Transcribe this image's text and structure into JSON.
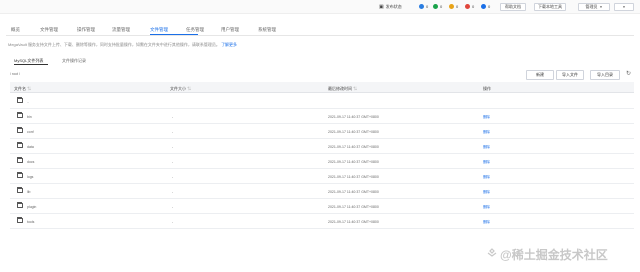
{
  "topbar": {
    "items": [
      {
        "label": "发布状态",
        "color": "#444444"
      },
      {
        "label": "0",
        "color": "#2a7de1"
      },
      {
        "label": "0",
        "color": "#1aa34a"
      },
      {
        "label": "0",
        "color": "#e8a317"
      },
      {
        "label": "0",
        "color": "#e0463c"
      },
      {
        "label": "0",
        "color": "#1a6fe8"
      }
    ],
    "buttons": [
      "帮助文档",
      "下载本地工具",
      "管理员"
    ]
  },
  "nav": {
    "tabs": [
      "概览",
      "文件管理",
      "操作管理",
      "流量管理",
      "文件管理",
      "任务管理",
      "用户管理",
      "系统管理"
    ],
    "active_index": 4
  },
  "notice": {
    "text": "MegaVault 服务支持文件上传、下载、删除等操作，同时支持批量操作，如需在文件夹中进行其他操作，请联系管理员。",
    "link": "了解更多"
  },
  "subtabs": [
    "MySQL文件列表",
    "文件操作记录"
  ],
  "breadcrumb": "/ root /",
  "actions": [
    "新建",
    "导入文件",
    "导入目录"
  ],
  "table": {
    "headers": [
      "文件名",
      "文件大小",
      "最后修改时间",
      "操作"
    ],
    "rows": [
      {
        "name": "..",
        "size": "",
        "time": "",
        "op": ""
      },
      {
        "name": "bin",
        "size": "-",
        "time": "2021-09-17 11:40:37 GMT+0800",
        "op": "删除"
      },
      {
        "name": "conf",
        "size": "-",
        "time": "2021-09-17 11:40:37 GMT+0800",
        "op": "删除"
      },
      {
        "name": "data",
        "size": "-",
        "time": "2021-09-17 11:40:37 GMT+0800",
        "op": "删除"
      },
      {
        "name": "docs",
        "size": "-",
        "time": "2021-09-17 11:40:37 GMT+0800",
        "op": "删除"
      },
      {
        "name": "logs",
        "size": "-",
        "time": "2021-09-17 11:40:37 GMT+0800",
        "op": "删除"
      },
      {
        "name": "lib",
        "size": "-",
        "time": "2021-09-17 11:40:37 GMT+0800",
        "op": "删除"
      },
      {
        "name": "plugin",
        "size": "-",
        "time": "2021-09-17 11:40:37 GMT+0800",
        "op": "删除"
      },
      {
        "name": "tools",
        "size": "-",
        "time": "2021-09-17 11:40:37 GMT+0800",
        "op": "删除"
      }
    ]
  },
  "watermark": "@稀土掘金技术社区"
}
